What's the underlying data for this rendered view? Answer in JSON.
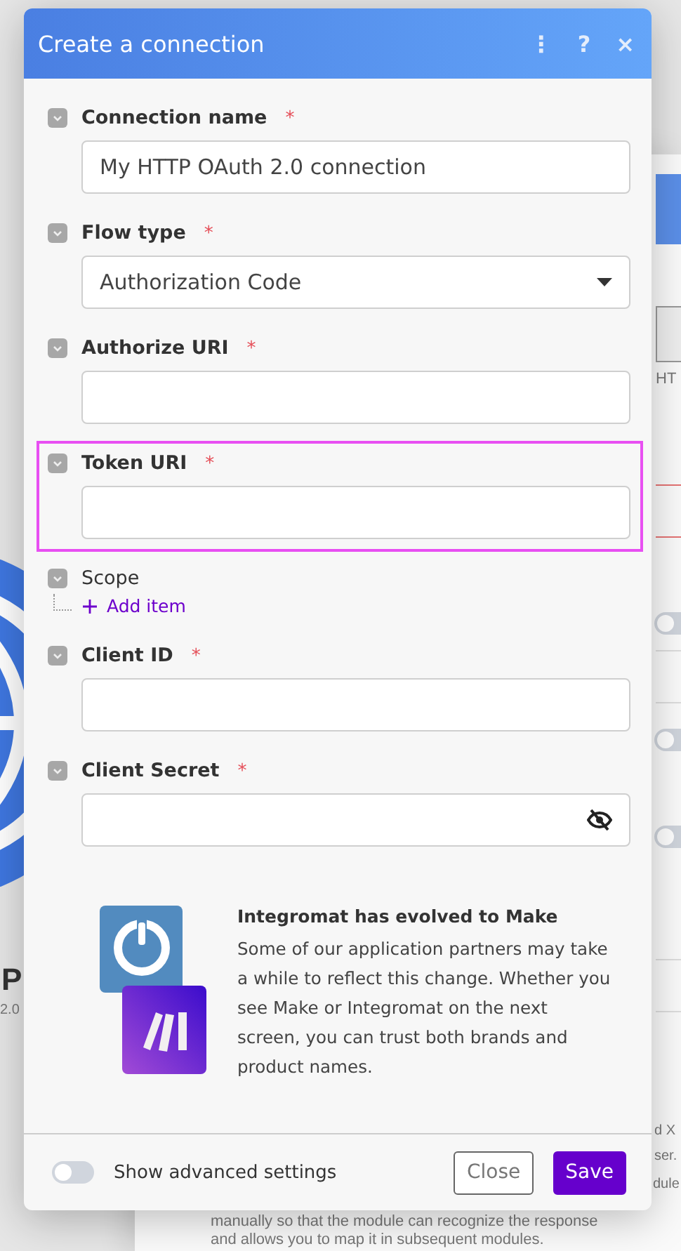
{
  "background": {
    "module_title": "P",
    "module_version": "2.0",
    "panel_texts": [
      "HT",
      "d X",
      "ser.",
      "dule",
      "manually so that the module can recognize the response",
      "and allows you to map it in subsequent modules."
    ],
    "toggles": [
      {
        "on": false
      },
      {
        "on": false
      },
      {
        "on": false
      }
    ]
  },
  "required_mark": "*",
  "dialog": {
    "title": "Create a connection",
    "header_icons": [
      "⋮",
      "?",
      "×"
    ],
    "fields": [
      {
        "kind": "text",
        "label": "Connection name",
        "required": true,
        "value": "My HTTP OAuth 2.0 connection",
        "highlighted": false
      },
      {
        "kind": "select",
        "label": "Flow type",
        "required": true,
        "value": "Authorization Code",
        "highlighted": false
      },
      {
        "kind": "text",
        "label": "Authorize URI",
        "required": true,
        "highlighted": false
      },
      {
        "kind": "text",
        "label": "Token URI",
        "required": true,
        "highlighted": true
      },
      {
        "kind": "array",
        "label": "Scope",
        "required": false,
        "add_label": "Add item",
        "highlighted": false
      },
      {
        "kind": "text",
        "label": "Client ID",
        "required": true,
        "highlighted": false
      },
      {
        "kind": "password",
        "label": "Client Secret",
        "required": true,
        "highlighted": false
      }
    ],
    "notice": {
      "title": "Integromat has evolved to Make",
      "text": "Some of our application partners may take a while to reflect this change. Whether you see Make or Integromat on the next screen, you can trust both brands and product names."
    },
    "advanced_toggle": {
      "label": "Show advanced settings",
      "on": false
    },
    "buttons": [
      {
        "label": "Close",
        "kind": "secondary"
      },
      {
        "label": "Save",
        "kind": "primary"
      }
    ]
  }
}
